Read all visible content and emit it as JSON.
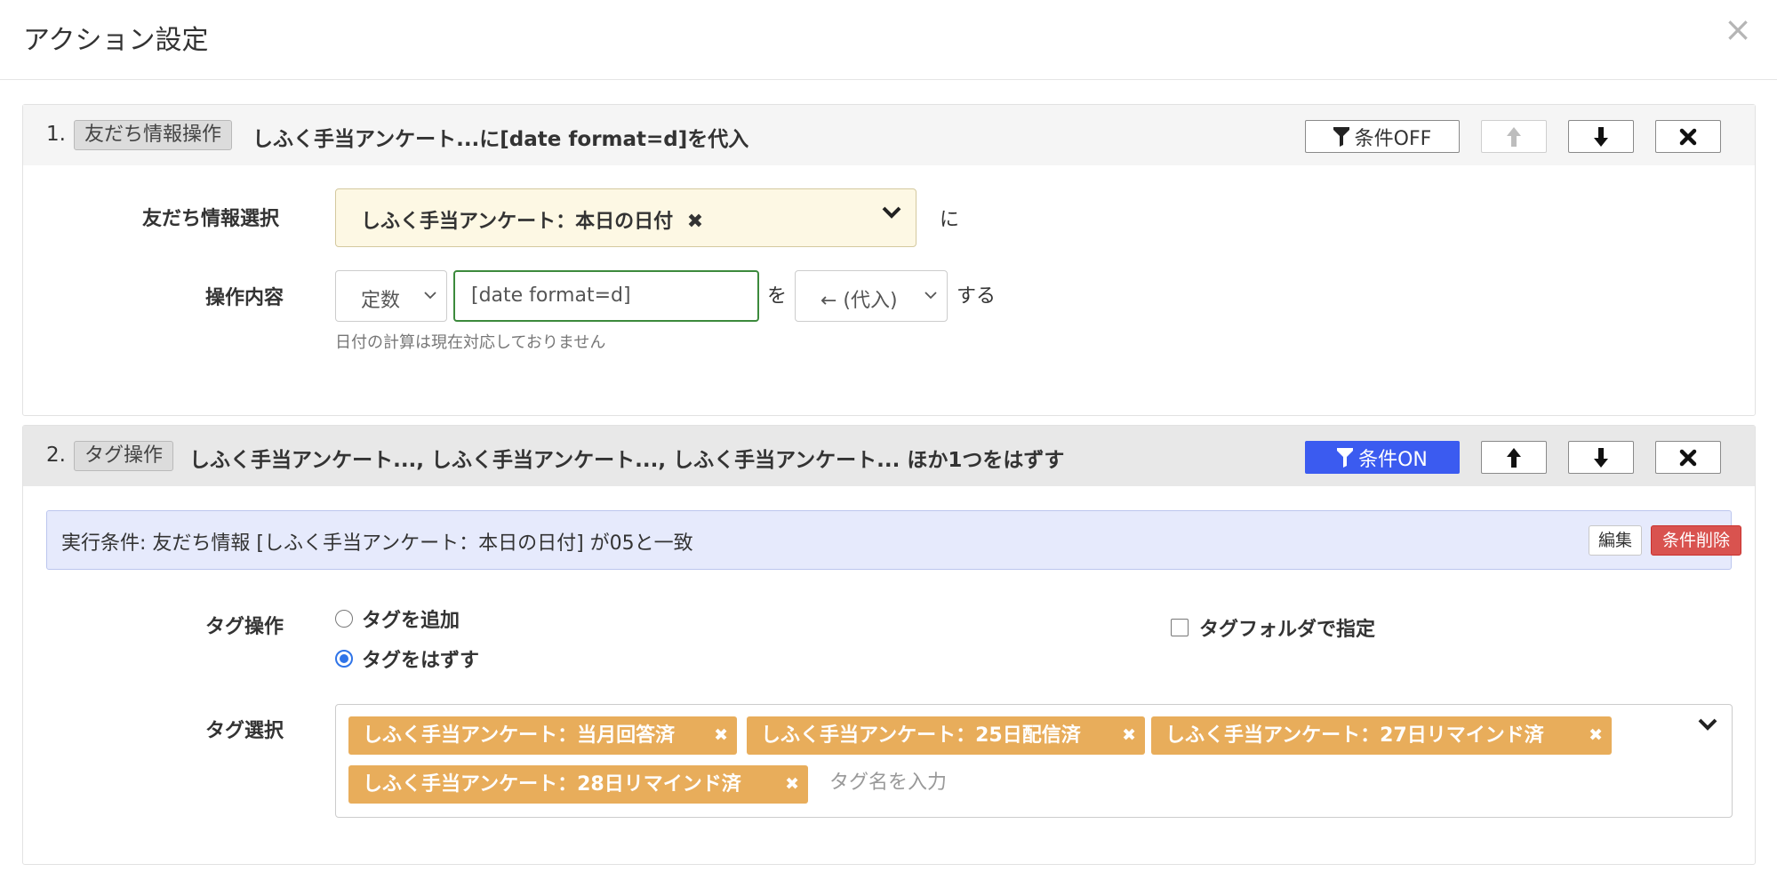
{
  "modal": {
    "title": "アクション設定",
    "close_glyph": "×"
  },
  "action1": {
    "number": "1.",
    "type_badge": "友だち情報操作",
    "summary": "しふく手当アンケート...に[date format=d]を代入",
    "buttons": {
      "condition": "条件OFF"
    },
    "friend_select": {
      "label": "友だち情報選択",
      "value": "しふく手当アンケート：本日の日付",
      "remove_glyph": "✖",
      "suffix": "に"
    },
    "operation": {
      "label": "操作内容",
      "type": "定数",
      "value": "[date format=d]",
      "particle": "を",
      "operator": "← (代入)",
      "suffix": "する",
      "hint": "日付の計算は現在対応しておりません"
    }
  },
  "action2": {
    "number": "2.",
    "type_badge": "タグ操作",
    "summary": "しふく手当アンケート..., しふく手当アンケート..., しふく手当アンケート... ほか1つをはずす",
    "buttons": {
      "condition": "条件ON"
    },
    "condition_bar": {
      "text": "実行条件: 友だち情報 [しふく手当アンケート：本日の日付] が05と一致",
      "edit": "編集",
      "delete": "条件削除"
    },
    "tag_operation": {
      "label": "タグ操作",
      "options": [
        {
          "label": "タグを追加",
          "checked": false
        },
        {
          "label": "タグをはずす",
          "checked": true
        }
      ],
      "folder_checkbox": {
        "label": "タグフォルダで指定",
        "checked": false
      }
    },
    "tag_select": {
      "label": "タグ選択",
      "tags": [
        {
          "label": "しふく手当アンケート：当月回答済",
          "remove": "✖"
        },
        {
          "label": "しふく手当アンケート：25日配信済",
          "remove": "✖"
        },
        {
          "label": "しふく手当アンケート：27日リマインド済",
          "remove": "✖"
        },
        {
          "label": "しふく手当アンケート：28日リマインド済",
          "remove": "✖"
        }
      ],
      "placeholder": "タグ名を入力"
    }
  },
  "colors": {
    "accent_blue": "#3b5bf0",
    "tag_orange": "#e8ad5b",
    "danger_red": "#d9534f",
    "condition_bg": "#e6eafc",
    "select_bg": "#fdf8e4"
  },
  "icons": [
    "close-icon",
    "filter-icon",
    "arrow-up-icon",
    "arrow-down-icon",
    "delete-icon",
    "chevron-down-icon",
    "caret-down-icon",
    "remove-icon"
  ]
}
